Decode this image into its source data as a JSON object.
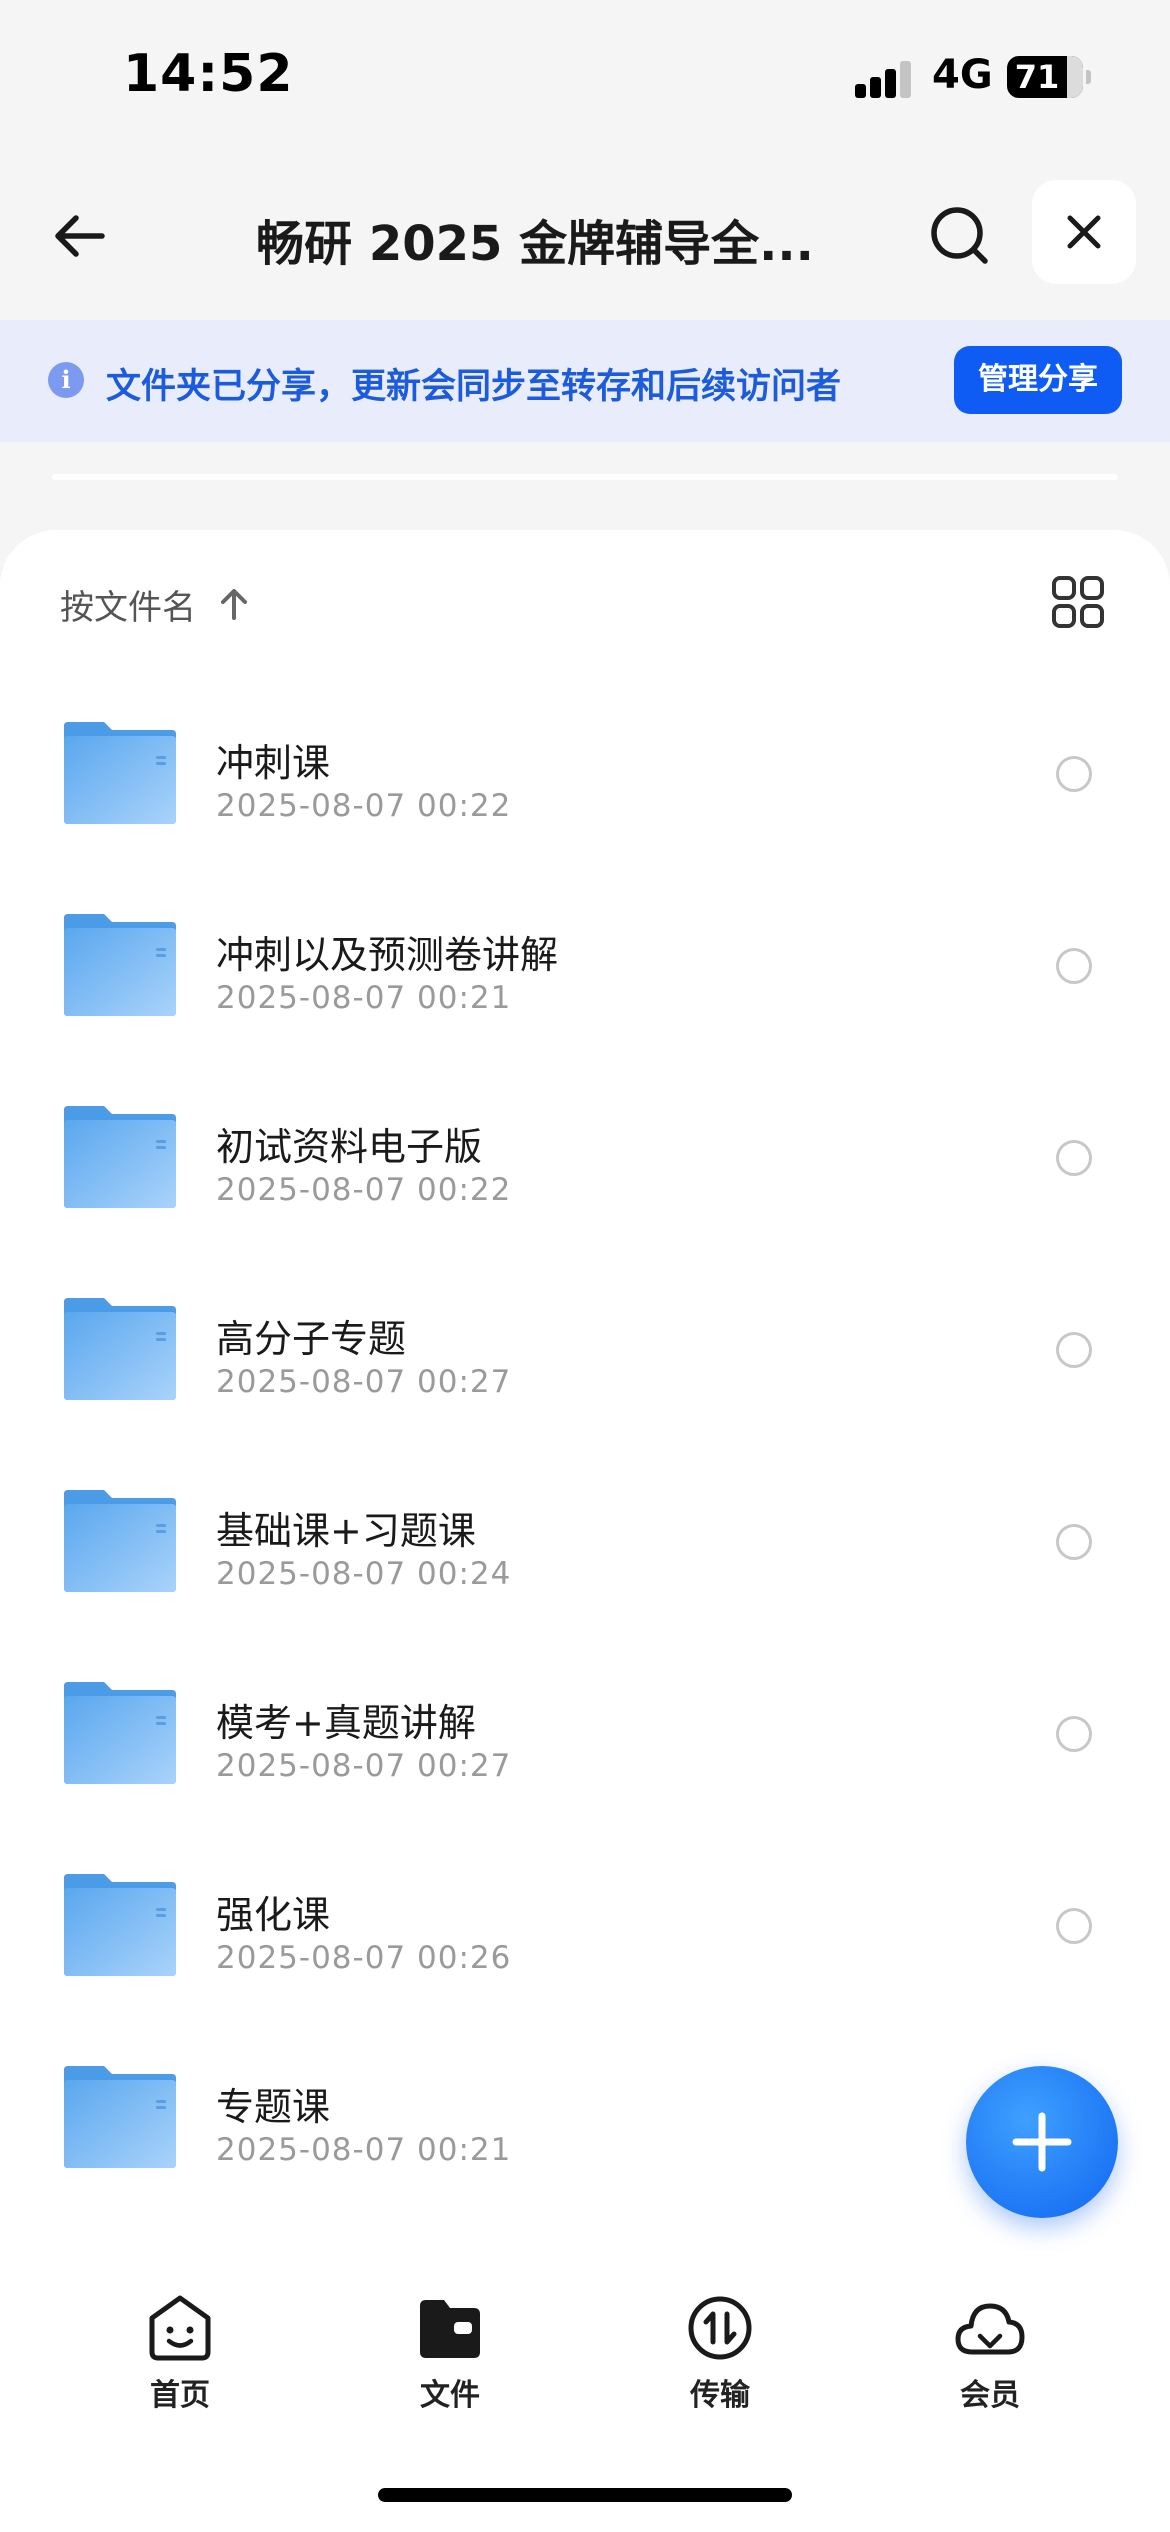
{
  "status_bar": {
    "time": "14:52",
    "network": "4G",
    "battery": "71"
  },
  "header": {
    "title": "畅研 2025 金牌辅导全...",
    "back_icon": "arrow-left-icon",
    "search_icon": "search-icon",
    "close_icon": "close-icon"
  },
  "share_banner": {
    "text": "文件夹已分享，更新会同步至转存和后续访问者",
    "button_label": "管理分享",
    "icon": "info-icon"
  },
  "sort": {
    "label": "按文件名",
    "direction_icon": "arrow-up-icon",
    "view_toggle_icon": "grid-view-icon"
  },
  "files": [
    {
      "name": "冲刺课",
      "date": "2025-08-07 00:22"
    },
    {
      "name": "冲刺以及预测卷讲解",
      "date": "2025-08-07 00:21"
    },
    {
      "name": "初试资料电子版",
      "date": "2025-08-07 00:22"
    },
    {
      "name": "高分子专题",
      "date": "2025-08-07 00:27"
    },
    {
      "name": "基础课+习题课",
      "date": "2025-08-07 00:24"
    },
    {
      "name": "模考+真题讲解",
      "date": "2025-08-07 00:27"
    },
    {
      "name": "强化课",
      "date": "2025-08-07 00:26"
    },
    {
      "name": "专题课",
      "date": "2025-08-07 00:21"
    }
  ],
  "fab": {
    "icon": "plus-icon"
  },
  "tab_bar": {
    "items": [
      {
        "label": "首页",
        "icon": "home-smile-icon"
      },
      {
        "label": "文件",
        "icon": "folder-icon"
      },
      {
        "label": "传输",
        "icon": "transfer-icon"
      },
      {
        "label": "会员",
        "icon": "cloud-icon"
      }
    ]
  },
  "colors": {
    "accent": "#0f5cf5",
    "banner_bg": "#e9edfb",
    "banner_text": "#1c5bdc",
    "folder": "#6fb3f2"
  }
}
